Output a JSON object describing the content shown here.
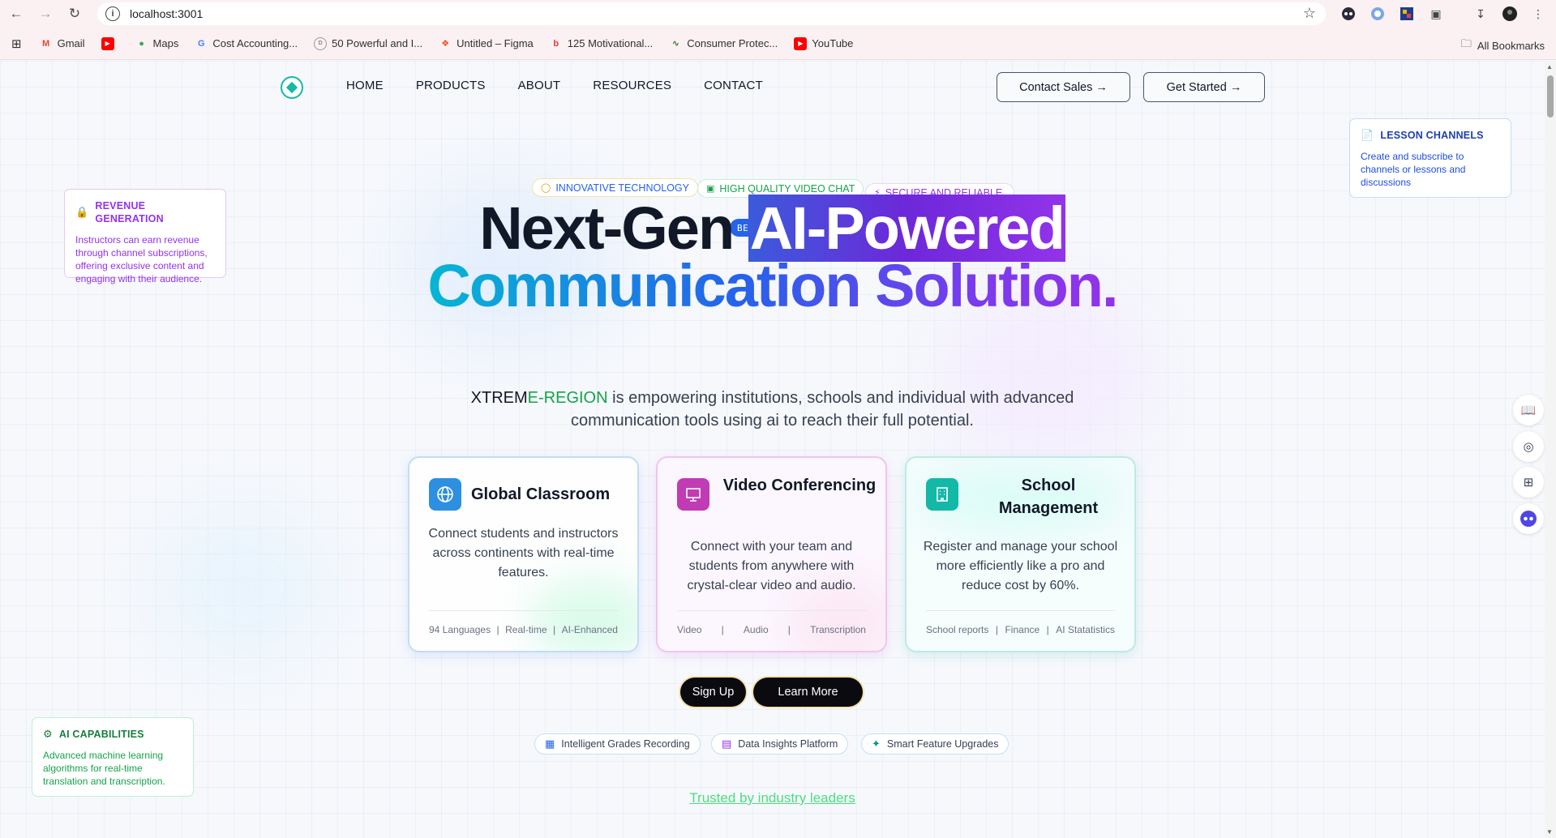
{
  "browser": {
    "url": "localhost:3001",
    "bookmarks": [
      {
        "label": "Gmail",
        "icon": "gmail-icon"
      },
      {
        "label": "",
        "icon": "youtube-icon"
      },
      {
        "label": "Maps",
        "icon": "maps-icon"
      },
      {
        "label": "Cost Accounting...",
        "icon": "google-icon"
      },
      {
        "label": "50 Powerful and I...",
        "icon": "site-icon"
      },
      {
        "label": "Untitled – Figma",
        "icon": "figma-icon"
      },
      {
        "label": "125 Motivational...",
        "icon": "site-icon"
      },
      {
        "label": "Consumer Protec...",
        "icon": "site-icon"
      },
      {
        "label": "YouTube",
        "icon": "youtube-icon"
      }
    ],
    "all_bookmarks": "All Bookmarks"
  },
  "nav": {
    "links": [
      "HOME",
      "PRODUCTS",
      "ABOUT",
      "RESOURCES",
      "CONTACT"
    ],
    "contact_sales": "Contact Sales →",
    "get_started": "Get Started →"
  },
  "side_cards": {
    "revenue": {
      "title": "REVENUE GENERATION",
      "text": "Instructors can earn revenue through channel subscriptions, offering exclusive content and engaging with their audience."
    },
    "lesson": {
      "title": "LESSON CHANNELS",
      "text": "Create and subscribe to channels or lessons and discussions"
    },
    "ai": {
      "title": "AI CAPABILITIES",
      "text": "Advanced machine learning algorithms for real-time translation and transcription."
    }
  },
  "pills": [
    "INNOVATIVE TECHNOLOGY",
    "HIGH QUALITY VIDEO CHAT",
    "SECURE AND RELIABLE."
  ],
  "beta": "BETA VERSION",
  "hero": {
    "line1_a": "Next-Gen ",
    "line1_b": "AI-Powered",
    "line2": "Communication Solution.",
    "sub_brand_a": "XTREM",
    "sub_brand_b": "E-REGION",
    "sub_rest_1": " is empowering institutions, schools and individual with advanced",
    "sub_rest_2": "communication tools using ai to reach their full potential."
  },
  "cards": [
    {
      "title": "Global Classroom",
      "desc": "Connect students and instructors across continents with real-time features.",
      "meta": [
        "94 Languages",
        "|",
        "Real-time",
        "|",
        "AI-Enhanced"
      ]
    },
    {
      "title": "Video Conferencing",
      "desc": "Connect with your team and students from anywhere with crystal-clear video and audio.",
      "meta": [
        "Video",
        "|",
        "Audio",
        "|",
        "Transcription"
      ]
    },
    {
      "title": "School Management",
      "desc": "Register and manage your school more efficiently like a pro and reduce cost by 60%.",
      "meta": [
        "School reports",
        "|",
        "Finance",
        "|",
        "AI Statatistics"
      ]
    }
  ],
  "cta": {
    "signup": "Sign Up",
    "learn": "Learn More"
  },
  "features": [
    "Intelligent Grades Recording",
    "Data Insights Platform",
    "Smart Feature Upgrades"
  ],
  "trusted": "Trusted by industry leaders",
  "colors": {
    "teal": "#14b8a6",
    "blue": "#2563eb",
    "purple": "#9333ea",
    "green": "#16a34a"
  }
}
